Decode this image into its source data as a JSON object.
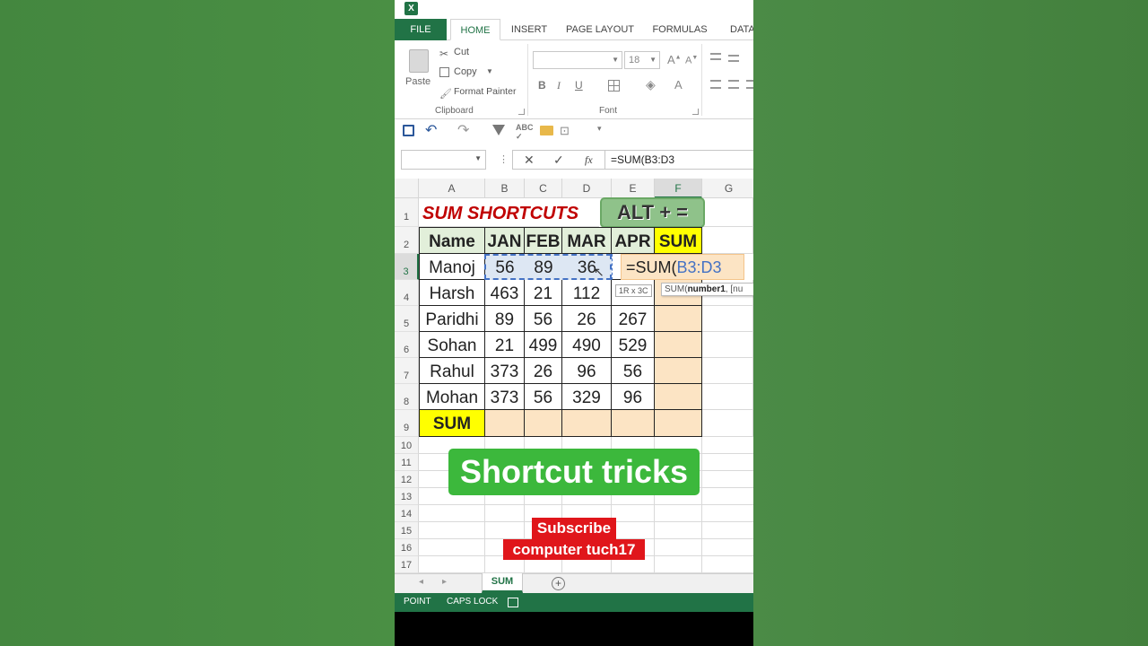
{
  "ribbon_tabs": [
    "FILE",
    "HOME",
    "INSERT",
    "PAGE LAYOUT",
    "FORMULAS",
    "DATA"
  ],
  "clipboard": {
    "paste": "Paste",
    "cut": "Cut",
    "copy": "Copy",
    "format_painter": "Format Painter",
    "group_label": "Clipboard"
  },
  "font": {
    "size": "18",
    "group_label": "Font",
    "bold": "B",
    "italic": "I",
    "underline": "U"
  },
  "formula_bar": {
    "fx": "fx",
    "formula": "=SUM(B3:D3"
  },
  "columns": [
    "A",
    "B",
    "C",
    "D",
    "E",
    "F",
    "G"
  ],
  "rows": [
    "1",
    "2",
    "3",
    "4",
    "5",
    "6",
    "7",
    "8",
    "9",
    "10",
    "11",
    "12",
    "13",
    "14",
    "15",
    "16",
    "17"
  ],
  "sheet": {
    "title": "SUM SHORTCUTS",
    "shortcut_badge": "ALT + =",
    "headers": [
      "Name",
      "JAN",
      "FEB",
      "MAR",
      "APR",
      "SUM"
    ],
    "data": [
      [
        "Manoj",
        "56",
        "89",
        "36",
        ""
      ],
      [
        "Harsh",
        "463",
        "21",
        "112",
        ""
      ],
      [
        "Paridhi",
        "89",
        "56",
        "26",
        "267"
      ],
      [
        "Sohan",
        "21",
        "499",
        "490",
        "529"
      ],
      [
        "Rahul",
        "373",
        "26",
        "96",
        "56"
      ],
      [
        "Mohan",
        "373",
        "56",
        "329",
        "96"
      ]
    ],
    "sum_label": "SUM",
    "editing_cell_prefix": "=SUM(",
    "editing_cell_ref": "B3:D3",
    "range_tooltip": "1R x 3C",
    "fn_tooltip_name": "SUM(",
    "fn_tooltip_arg": "number1",
    "fn_tooltip_rest": ", [nu"
  },
  "sheet_tab": "SUM",
  "status": {
    "mode": "POINT",
    "caps": "CAPS LOCK"
  },
  "overlays": {
    "banner": "Shortcut tricks",
    "subscribe_line1": "Subscribe",
    "subscribe_line2": "computer tuch17"
  },
  "colors": {
    "excel_green": "#217346",
    "header_fill": "#e2efda",
    "sum_fill": "#ffff00",
    "peach": "#fce4c4",
    "banner_green": "#3cb83c",
    "subscribe_red": "#e0161b"
  }
}
